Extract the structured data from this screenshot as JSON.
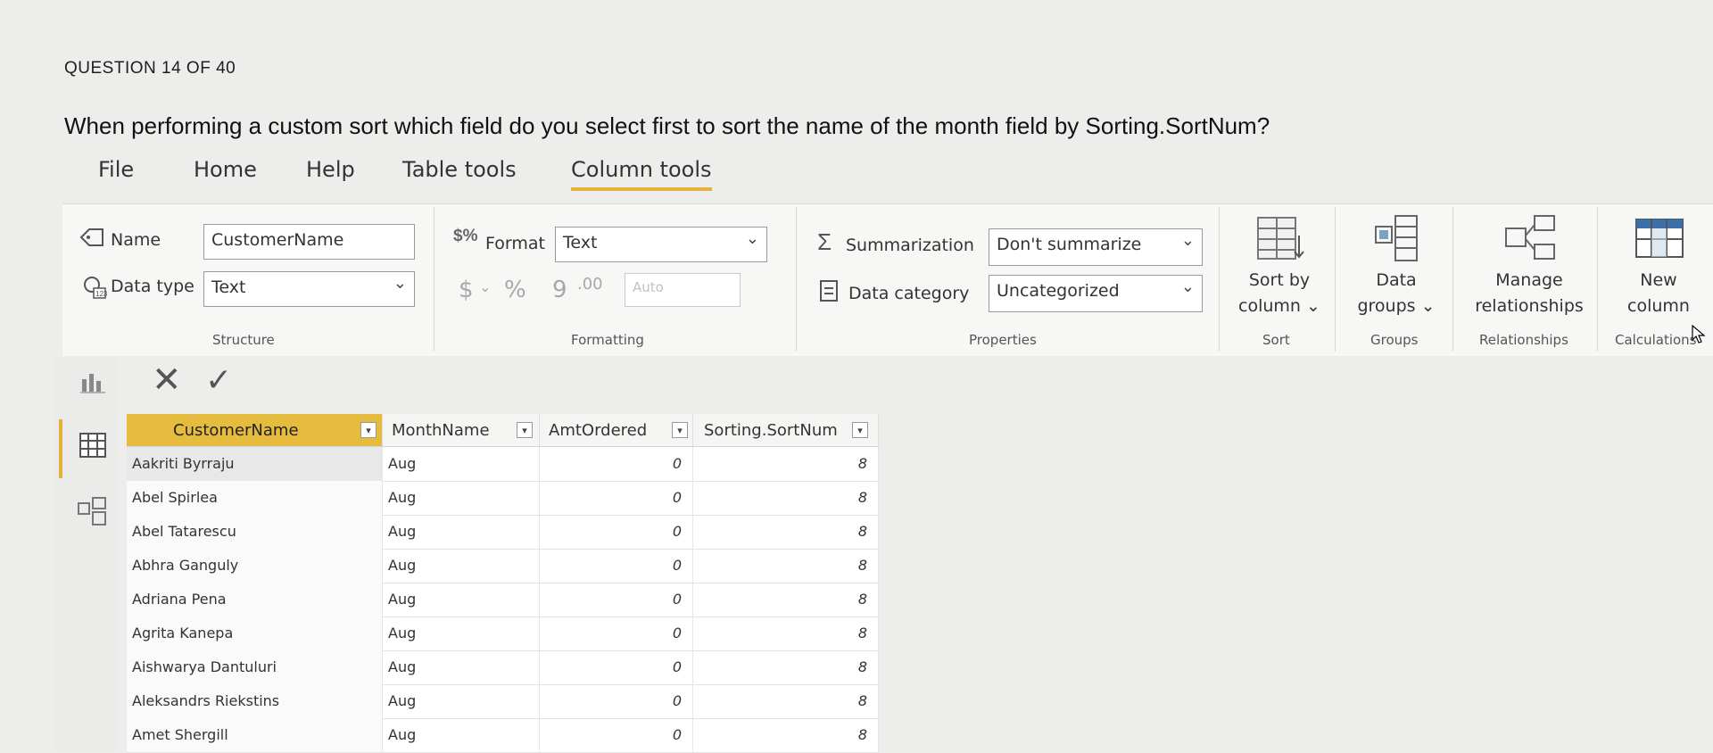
{
  "question": {
    "counter": "QUESTION 14 OF 40",
    "text": "When performing a custom sort which field do you select first to sort the name of the month field by Sorting.SortNum?"
  },
  "menu": {
    "tabs": [
      "File",
      "Home",
      "Help",
      "Table tools",
      "Column tools"
    ],
    "active_tab": "Column tools"
  },
  "ribbon": {
    "structure": {
      "name_label": "Name",
      "name_value": "CustomerName",
      "datatype_label": "Data type",
      "datatype_value": "Text",
      "group_label": "Structure"
    },
    "formatting": {
      "format_label": "Format",
      "format_value": "Text",
      "currency_symbol": "$",
      "percent_symbol": "%",
      "comma_symbol": "9",
      "decimal_symbol": ".00",
      "auto_value": "Auto",
      "group_label": "Formatting"
    },
    "properties": {
      "summarization_label": "Summarization",
      "summarization_value": "Don't summarize",
      "datacategory_label": "Data category",
      "datacategory_value": "Uncategorized",
      "group_label": "Properties"
    },
    "sort": {
      "button_line1": "Sort by",
      "button_line2": "column",
      "group_label": "Sort"
    },
    "groups": {
      "button_line1": "Data",
      "button_line2": "groups",
      "group_label": "Groups"
    },
    "relationships": {
      "button_line1": "Manage",
      "button_line2": "relationships",
      "group_label": "Relationships"
    },
    "calculations": {
      "button_line1": "New",
      "button_line2": "column",
      "group_label": "Calculations"
    }
  },
  "table": {
    "columns": [
      "CustomerName",
      "MonthName",
      "AmtOrdered",
      "Sorting.SortNum"
    ],
    "selected_column": "CustomerName",
    "rows": [
      [
        "Aakriti Byrraju",
        "Aug",
        "0",
        "8"
      ],
      [
        "Abel Spirlea",
        "Aug",
        "0",
        "8"
      ],
      [
        "Abel Tatarescu",
        "Aug",
        "0",
        "8"
      ],
      [
        "Abhra Ganguly",
        "Aug",
        "0",
        "8"
      ],
      [
        "Adriana Pena",
        "Aug",
        "0",
        "8"
      ],
      [
        "Agrita Kanepa",
        "Aug",
        "0",
        "8"
      ],
      [
        "Aishwarya Dantuluri",
        "Aug",
        "0",
        "8"
      ],
      [
        "Aleksandrs Riekstins",
        "Aug",
        "0",
        "8"
      ],
      [
        "Amet Shergill",
        "Aug",
        "0",
        "8"
      ]
    ]
  }
}
